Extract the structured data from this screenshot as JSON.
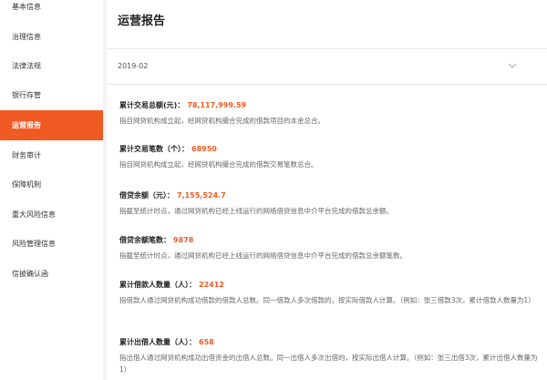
{
  "sidebar": {
    "items": [
      {
        "label": "基本信息"
      },
      {
        "label": "治理信息"
      },
      {
        "label": "法律法规"
      },
      {
        "label": "银行存管"
      },
      {
        "label": "运营报告"
      },
      {
        "label": "财务审计"
      },
      {
        "label": "保障机制"
      },
      {
        "label": "重大风险信息"
      },
      {
        "label": "风险管理信息"
      },
      {
        "label": "信披确认函"
      }
    ],
    "active_index": 4
  },
  "main": {
    "title": "运营报告",
    "period_select": {
      "value": "2019-02",
      "icon": "chevron-down-icon"
    },
    "metrics": [
      {
        "label": "累计交易总额(元)：",
        "value": "78,117,999.59",
        "desc": "指自网贷机构成立起，经网贷机构撮合完成的借款项目的本金总合。"
      },
      {
        "label": "累计交易笔数（个）：",
        "value": "68950",
        "desc": "指自网贷机构成立起，经网贷机构撮合完成的借款交易笔数总合。"
      },
      {
        "label": "借贷余额（元）：",
        "value": "7,155,524.7",
        "desc": "指截至统计时点，通过网贷机构已经上线运行的网络借贷信息中介平台完成的借款总余额。"
      },
      {
        "label": "借贷余额笔数：",
        "value": "9878",
        "desc": "指截至统计时点，通过网贷机构已经上线运行的网络借贷信息中介平台完成的借款总余额笔数。"
      },
      {
        "label": "累计借款人数量（人）：",
        "value": "22412",
        "desc": "指借款人通过网贷机构成功借款的借款人总数。同一借款人多次借款的，按实际借款人计算。（例如：张三借款3次，累计借款人数量为1）"
      },
      {
        "label": "累计出借人数量（人）：",
        "value": "658",
        "desc": "指出借人通过网贷机构成功出借资金的出借人总数。同一出借人多次出借的，按实际出借人计算。（例如：张三出借3次，累计出借人数量为1）"
      }
    ]
  },
  "colors": {
    "accent": "#f15a22",
    "sidebar_bg": "#ffffff",
    "page_bg": "#f4f4f4"
  }
}
